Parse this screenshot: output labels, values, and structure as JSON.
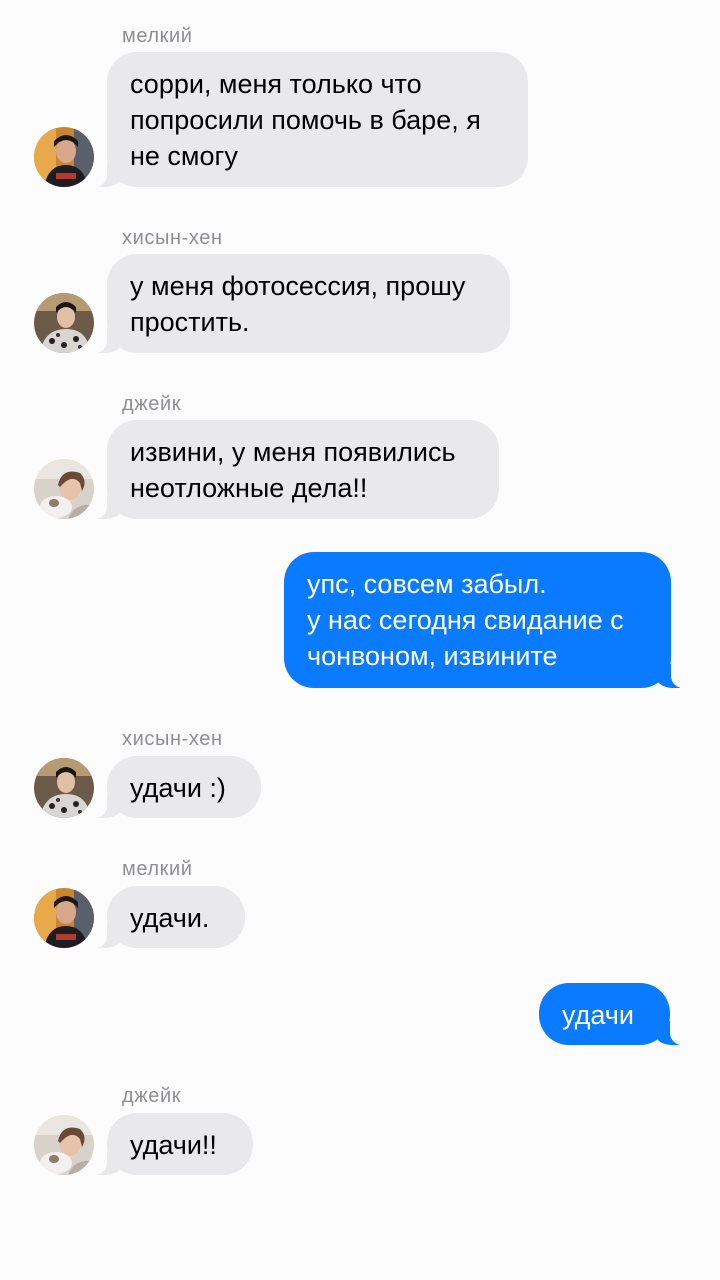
{
  "messages": [
    {
      "sender": "мелкий",
      "lines": [
        "сорри, меня только что",
        "попросили помочь в баре, я",
        "не смогу"
      ],
      "avatar": "melkiy-avatar"
    },
    {
      "sender": "хисын-хен",
      "lines": [
        "у меня фотосессия, прошу",
        "простить."
      ],
      "avatar": "heeseung-avatar"
    },
    {
      "sender": "джейк",
      "lines": [
        "извини, у меня появились",
        "неотложные дела!!"
      ],
      "avatar": "jake-avatar"
    },
    {
      "lines": [
        "упс, совсем забыл.",
        "у нас сегодня свидание с",
        "чонвоном, извините"
      ]
    },
    {
      "sender": "хисын-хен",
      "lines": [
        "удачи :)"
      ],
      "avatar": "heeseung-avatar"
    },
    {
      "sender": "мелкий",
      "lines": [
        "удачи."
      ],
      "avatar": "melkiy-avatar"
    },
    {
      "lines": [
        "удачи"
      ]
    },
    {
      "sender": "джейк",
      "lines": [
        "удачи!!"
      ],
      "avatar": "jake-avatar"
    }
  ],
  "colors": {
    "incoming_bubble": "#e9e9eb",
    "outgoing_bubble": "#0a7bff",
    "sender_name": "#8e8e93",
    "background": "#fdfcfd"
  }
}
